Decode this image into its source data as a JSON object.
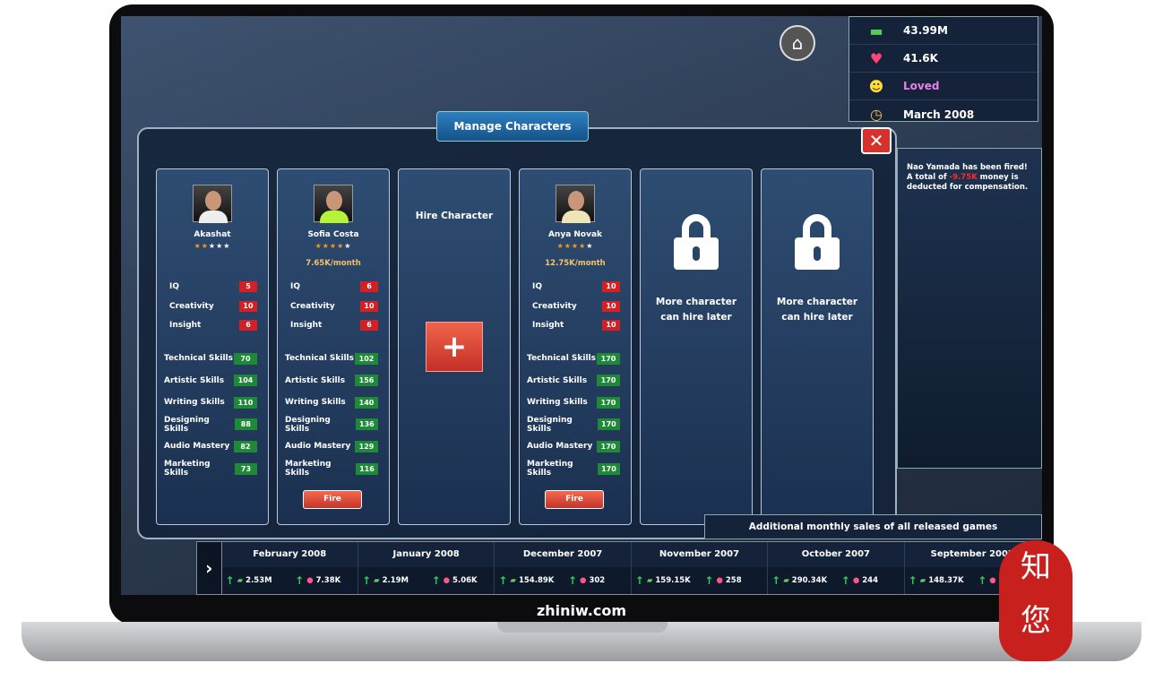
{
  "stats": {
    "money": "43.99M",
    "fans": "41.6K",
    "mood": "Loved",
    "date": "March 2008",
    "mood_color": "#e880e6"
  },
  "dialog": {
    "title": "Manage Characters",
    "close_icon": "close-icon"
  },
  "characters": [
    {
      "name": "Akashat",
      "stars": 2,
      "salary": "",
      "iq": "5",
      "creativity": "10",
      "insight": "6",
      "skills": [
        "70",
        "104",
        "110",
        "88",
        "82",
        "73"
      ],
      "shirt": "#eee",
      "fire": false
    },
    {
      "name": "Sofia Costa",
      "stars": 4,
      "salary": "7.65K/month",
      "iq": "6",
      "creativity": "10",
      "insight": "6",
      "skills": [
        "102",
        "156",
        "140",
        "136",
        "129",
        "116"
      ],
      "shirt": "#b7f23a",
      "fire": true
    },
    {
      "name": "Anya Novak",
      "stars": 4,
      "salary": "12.75K/month",
      "iq": "10",
      "creativity": "10",
      "insight": "10",
      "skills": [
        "170",
        "170",
        "170",
        "170",
        "170",
        "170"
      ],
      "shirt": "#efe3b8",
      "fire": true
    }
  ],
  "labels": {
    "iq": "IQ",
    "creativity": "Creativity",
    "insight": "Insight",
    "skills": [
      "Technical Skills",
      "Artistic Skills",
      "Writing Skills",
      "Designing Skills",
      "Audio Mastery",
      "Marketing Skills"
    ],
    "fire": "Fire",
    "hire": "Hire Character",
    "locked_line1": "More character",
    "locked_line2": "can hire later"
  },
  "notice": {
    "name": "Nao Yamada",
    "t1": " has been fired! A total of ",
    "amount": "-9.75K",
    "t2": " money is deducted for compensation."
  },
  "sales_title": "Additional monthly sales of all released games",
  "months": [
    {
      "month": "February 2008",
      "money": "2.53M",
      "fans": "7.38K"
    },
    {
      "month": "January 2008",
      "money": "2.19M",
      "fans": "5.06K"
    },
    {
      "month": "December 2007",
      "money": "154.89K",
      "fans": "302"
    },
    {
      "month": "November 2007",
      "money": "159.15K",
      "fans": "258"
    },
    {
      "month": "October 2007",
      "money": "290.34K",
      "fans": "244"
    },
    {
      "month": "September 2007",
      "money": "148.37K",
      "fans": ""
    }
  ],
  "brand": "zhiniw.com",
  "seal": "知您网"
}
